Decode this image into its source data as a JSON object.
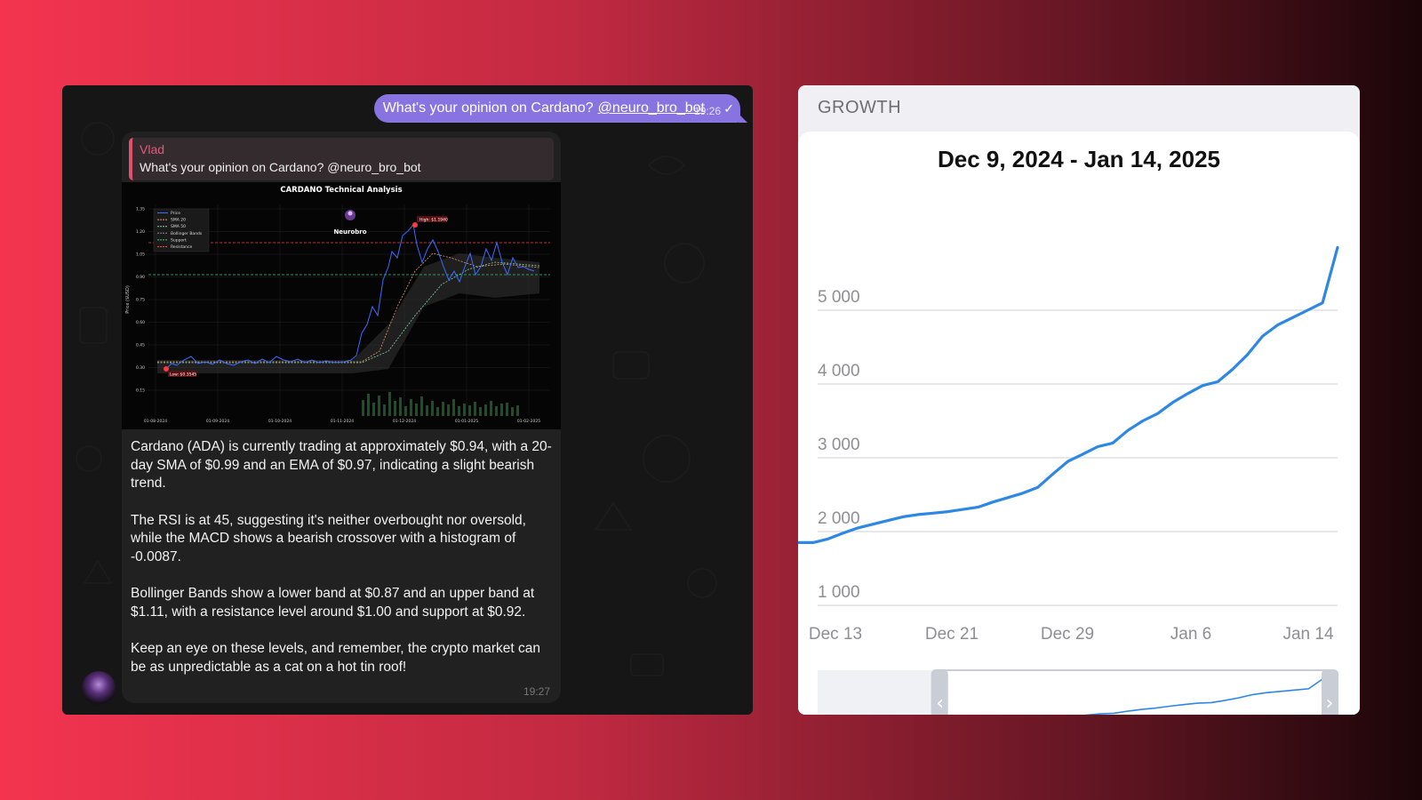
{
  "telegram": {
    "outgoing": {
      "text": "What's your opinion on Cardano?",
      "mention": "@neuro_bro_bot",
      "time": "19:26"
    },
    "reply": {
      "name": "Vlad",
      "text": "What's your opinion on Cardano? @neuro_bro_bot"
    },
    "ta_chart": {
      "title": "CARDANO Technical Analysis",
      "ylabel": "Price ($USD)",
      "watermark": "Neurobro",
      "legend": [
        "Price",
        "SMA 20",
        "SMA 50",
        "Bollinger Bands",
        "Support",
        "Resistance"
      ],
      "high_label": "High: $1.1940",
      "low_label": "Low: $0.3545",
      "y_ticks": [
        "1.35",
        "1.20",
        "1.05",
        "0.90",
        "0.75",
        "0.60",
        "0.45",
        "0.30",
        "0.15"
      ],
      "x_ticks": [
        "01-08-2024",
        "01-09-2024",
        "01-10-2024",
        "01-11-2024",
        "01-12-2024",
        "01-01-2025",
        "01-02-2025"
      ]
    },
    "message": {
      "paragraphs": [
        "Cardano (ADA) is currently trading at approximately $0.94, with a 20-day SMA of $0.99 and an EMA of $0.97, indicating a slight bearish trend.",
        "The RSI is at 45, suggesting it's neither overbought nor oversold, while the MACD shows a bearish crossover with a histogram of -0.0087.",
        "Bollinger Bands show a lower band at $0.87 and an upper band at $1.11, with a resistance level around $1.00 and support at $0.92.",
        "Keep an eye on these levels, and remember, the crypto market can be as unpredictable as a cat on a hot tin roof!"
      ],
      "time": "19:27"
    }
  },
  "growth": {
    "header": "GROWTH",
    "range_title": "Dec 9, 2024 - Jan 14, 2025",
    "y_ticks": [
      "1 000",
      "2 000",
      "3 000",
      "4 000",
      "5 000"
    ],
    "x_ticks": [
      "Dec 13",
      "Dec 21",
      "Dec 29",
      "Jan 6",
      "Jan 14"
    ],
    "navigator": {
      "left_handle": "‹",
      "right_handle": "›",
      "selection_start_fraction": 0.22,
      "selection_end_fraction": 1.0
    },
    "line_color": "#2e87e5"
  },
  "chart_data": [
    {
      "type": "line",
      "title": "Dec 9, 2024 - Jan 14, 2025",
      "xlabel": "",
      "ylabel": "",
      "x": [
        "Dec 9",
        "Dec 10",
        "Dec 11",
        "Dec 12",
        "Dec 13",
        "Dec 14",
        "Dec 15",
        "Dec 16",
        "Dec 17",
        "Dec 18",
        "Dec 19",
        "Dec 20",
        "Dec 21",
        "Dec 22",
        "Dec 23",
        "Dec 24",
        "Dec 25",
        "Dec 26",
        "Dec 27",
        "Dec 28",
        "Dec 29",
        "Dec 30",
        "Dec 31",
        "Jan 1",
        "Jan 2",
        "Jan 3",
        "Jan 4",
        "Jan 5",
        "Jan 6",
        "Jan 7",
        "Jan 8",
        "Jan 9",
        "Jan 10",
        "Jan 11",
        "Jan 12",
        "Jan 13",
        "Jan 14"
      ],
      "series": [
        {
          "values": [
            1850,
            1850,
            1900,
            1980,
            2050,
            2100,
            2150,
            2200,
            2230,
            2250,
            2270,
            2300,
            2330,
            2400,
            2460,
            2520,
            2600,
            2780,
            2950,
            3050,
            3150,
            3200,
            3370,
            3500,
            3600,
            3750,
            3870,
            3980,
            4030,
            4200,
            4400,
            4650,
            4800,
            4900,
            5000,
            5100,
            5850
          ]
        }
      ],
      "ylim": [
        1000,
        5800
      ],
      "grid": true,
      "color": "#2e87e5"
    }
  ]
}
